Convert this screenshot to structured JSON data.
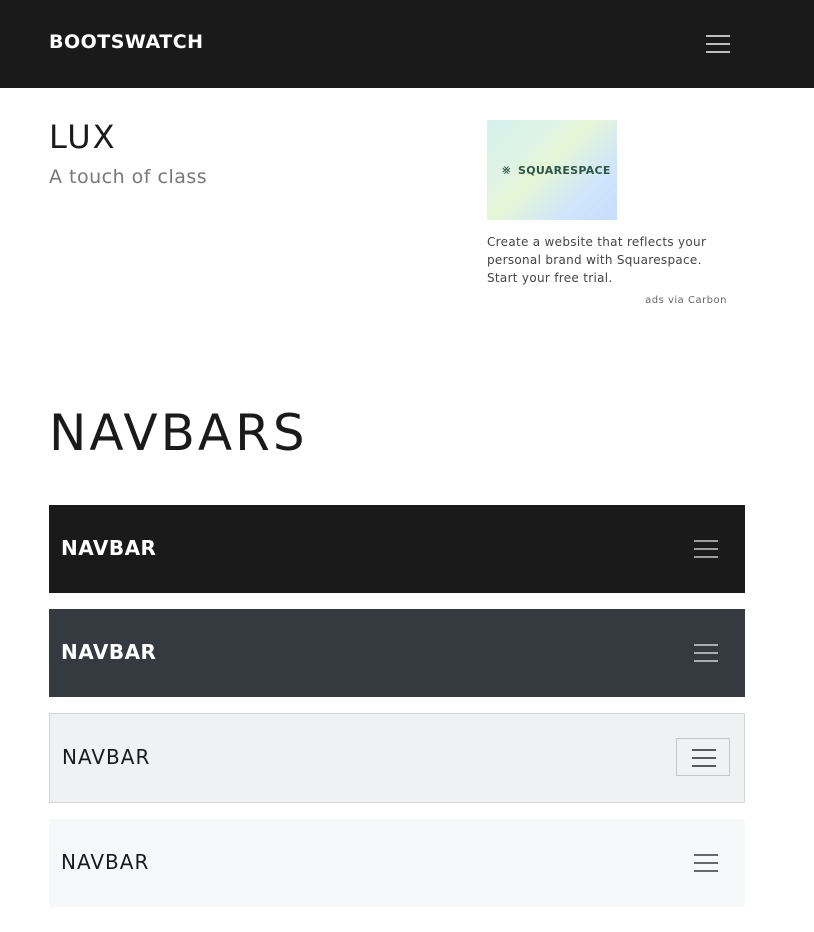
{
  "topbar": {
    "brand": "BOOTSWATCH"
  },
  "hero": {
    "title": "LUX",
    "subtitle": "A touch of class"
  },
  "ad": {
    "logo_text": "SQUARESPACE",
    "text": "Create a website that reflects your personal brand with Squarespace. Start your free trial.",
    "via": "ads via Carbon"
  },
  "section": {
    "title": "NAVBARS"
  },
  "navbars": [
    {
      "brand": "NAVBAR",
      "theme": "dark",
      "bg": "#1a1a1a"
    },
    {
      "brand": "NAVBAR",
      "theme": "slate",
      "bg": "#343a40"
    },
    {
      "brand": "NAVBAR",
      "theme": "light",
      "bg": "#f0f1f2"
    },
    {
      "brand": "NAVBAR",
      "theme": "white",
      "bg": "#f7f8f9"
    }
  ],
  "icons": {
    "toggler": "hamburger-menu-icon",
    "ad_logo": "squarespace-logo-icon"
  }
}
